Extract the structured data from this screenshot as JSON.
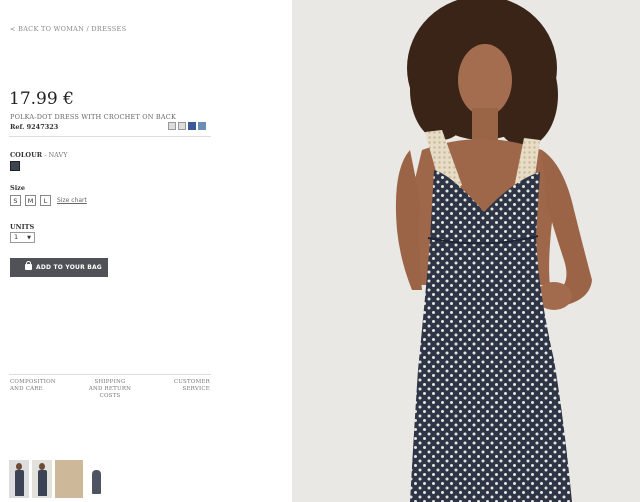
{
  "nav": {
    "back_link": "< BACK TO WOMAN / DRESSES"
  },
  "product": {
    "price": "17.99 €",
    "name": "POLKA-DOT DRESS WITH CROCHET ON BACK",
    "ref": "Ref. 9247323"
  },
  "share_icons": [
    "print-icon",
    "email-icon",
    "facebook-icon",
    "twitter-icon"
  ],
  "colour": {
    "label": "COLOUR",
    "value": " - NAVY",
    "swatch_color": "#3d4450"
  },
  "size": {
    "label": "Size",
    "options": [
      "S",
      "M",
      "L"
    ],
    "chart_link": "Size chart"
  },
  "units": {
    "label": "UNITS",
    "selected": "1"
  },
  "add_button": {
    "label": "ADD TO YOUR BAG"
  },
  "info_links": {
    "composition": "COMPOSITION AND CARE",
    "shipping": "SHIPPING AND RETURN COSTS",
    "customer": "CUSTOMER SERVICE"
  },
  "thumbnails": [
    "front-view",
    "back-view",
    "crochet-detail",
    "flat-view"
  ],
  "colors": {
    "background_photo": "#e9e8e4",
    "dress": "#2e3547",
    "button": "#4f5256"
  }
}
